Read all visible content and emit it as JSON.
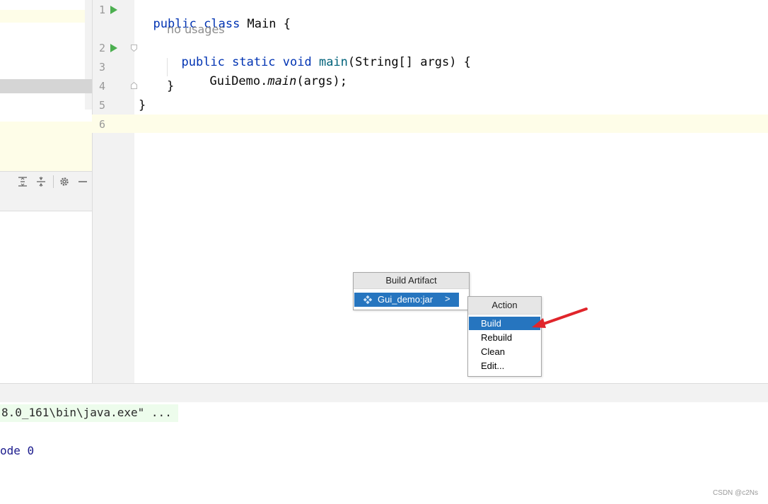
{
  "editor": {
    "line_numbers": [
      "1",
      "2",
      "3",
      "4",
      "5",
      "6"
    ],
    "code": {
      "l1_kw": "public class ",
      "l1_name": "Main {",
      "inlay_hint": "no usages",
      "l2_kw": "public static void ",
      "l2_fn": "main",
      "l2_rest": "(String[] args) {",
      "l3_class": "GuiDemo.",
      "l3_method": "main",
      "l3_rest": "(args);",
      "l4": "}",
      "l5": "}"
    }
  },
  "popup_artifact": {
    "title": "Build Artifact",
    "item": "Gui_demo:jar",
    "submenu_arrow": ">"
  },
  "popup_action": {
    "title": "Action",
    "items": [
      "Build",
      "Rebuild",
      "Clean",
      "Edit..."
    ]
  },
  "console": {
    "line1": "8.0_161\\bin\\java.exe\" ...",
    "line2": "ode 0"
  },
  "watermark": "CSDN @c2Ns",
  "colors": {
    "selection": "#2675bf",
    "arrow": "#e0252b",
    "run_icon": "#4caf50",
    "keyword": "#0033b3"
  },
  "icons": [
    "run-icon",
    "fold-icon",
    "expand-all-icon",
    "collapse-all-icon",
    "gear-icon",
    "minimize-icon",
    "artifact-icon",
    "chevron-right-icon",
    "annotation-arrow"
  ]
}
